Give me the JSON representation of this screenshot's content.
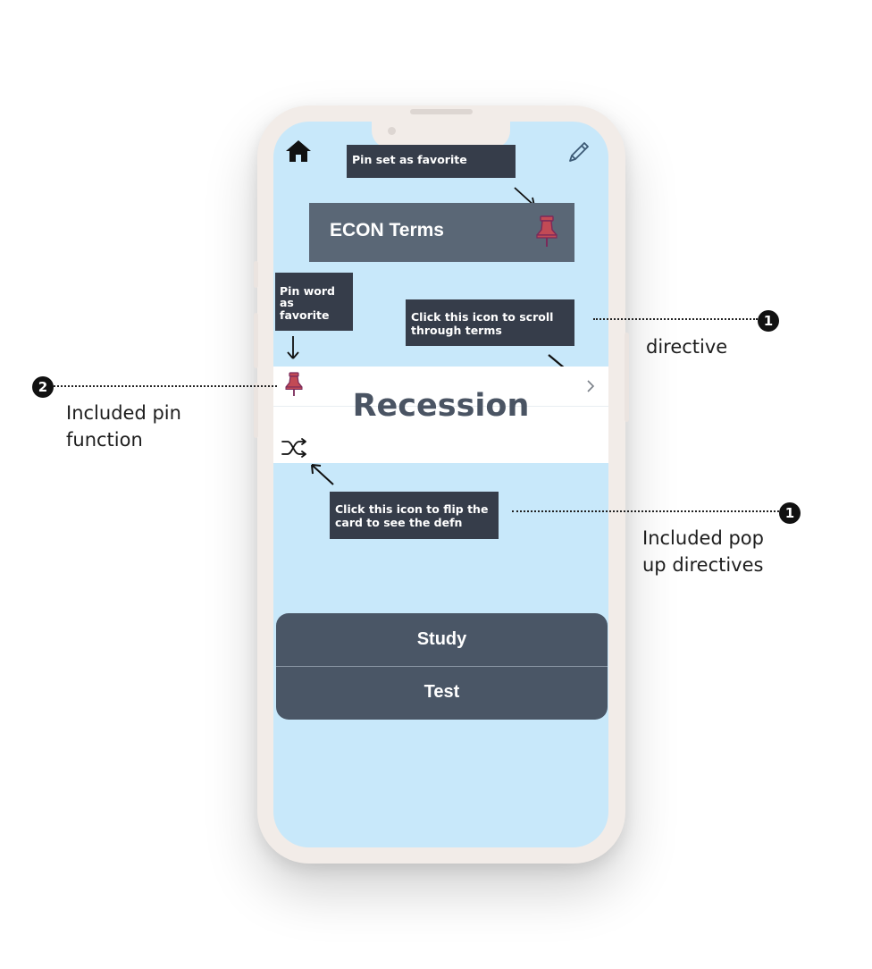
{
  "app": {
    "title": "ECON Terms",
    "card_term": "Recession",
    "buttons": {
      "study": "Study",
      "test": "Test"
    }
  },
  "icons": {
    "home": "home-icon",
    "edit": "pencil-icon",
    "pin": "pushpin-icon",
    "next": "chevron-right-icon",
    "shuffle": "shuffle-icon"
  },
  "tooltips": {
    "pin_set": "Pin set as favorite",
    "pin_word": [
      "Pin word",
      "as",
      "favorite"
    ],
    "scroll": [
      "Click this icon to scroll",
      "through terms"
    ],
    "flip": [
      "Click this icon to flip the",
      "card to see the defn"
    ]
  },
  "annotations": {
    "directive": {
      "badge": "1",
      "lines": [
        "directive"
      ]
    },
    "pin_function": {
      "badge": "2",
      "lines": [
        "Included pin",
        "function"
      ]
    },
    "popups": {
      "badge": "1",
      "lines": [
        "Included pop",
        "up directives"
      ]
    }
  },
  "colors": {
    "screen_bg": "#c8e8fa",
    "title_bar": "#5a6776",
    "tooltip_bg": "#363d4a",
    "button_bg": "#4a5666",
    "pin_fill": "#c24a55",
    "pin_outline": "#7a2a5a",
    "term_text": "#4a5463"
  }
}
